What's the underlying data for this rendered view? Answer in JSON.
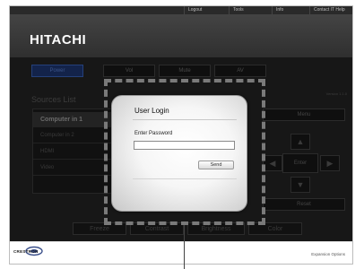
{
  "topnav": {
    "items": [
      "Logout",
      "Tools",
      "Info",
      "Contact IT Help"
    ]
  },
  "header": {
    "brand": "HITACHI"
  },
  "controls": {
    "power": "Power",
    "vol": "Vol",
    "mute": "Mute",
    "av_mute": "AV"
  },
  "sources": {
    "title": "Sources List",
    "items": [
      "Computer in 1",
      "Computer in 2",
      "HDMI",
      "Video"
    ]
  },
  "version": "Version 1.1.0",
  "side_controls": {
    "menu": "Menu",
    "enter": "Enter",
    "reset": "Reset",
    "up": "▲",
    "down": "▼",
    "left": "◀",
    "right": "▶"
  },
  "bottom_controls": [
    "Freeze",
    "Contrast",
    "Brightness",
    "Color"
  ],
  "footer": {
    "crestron": "CRESTRON",
    "expansion": "Expansion Options"
  },
  "dialog": {
    "title": "User Login",
    "password_label": "Enter Password",
    "password_value": "",
    "send_label": "Send"
  }
}
